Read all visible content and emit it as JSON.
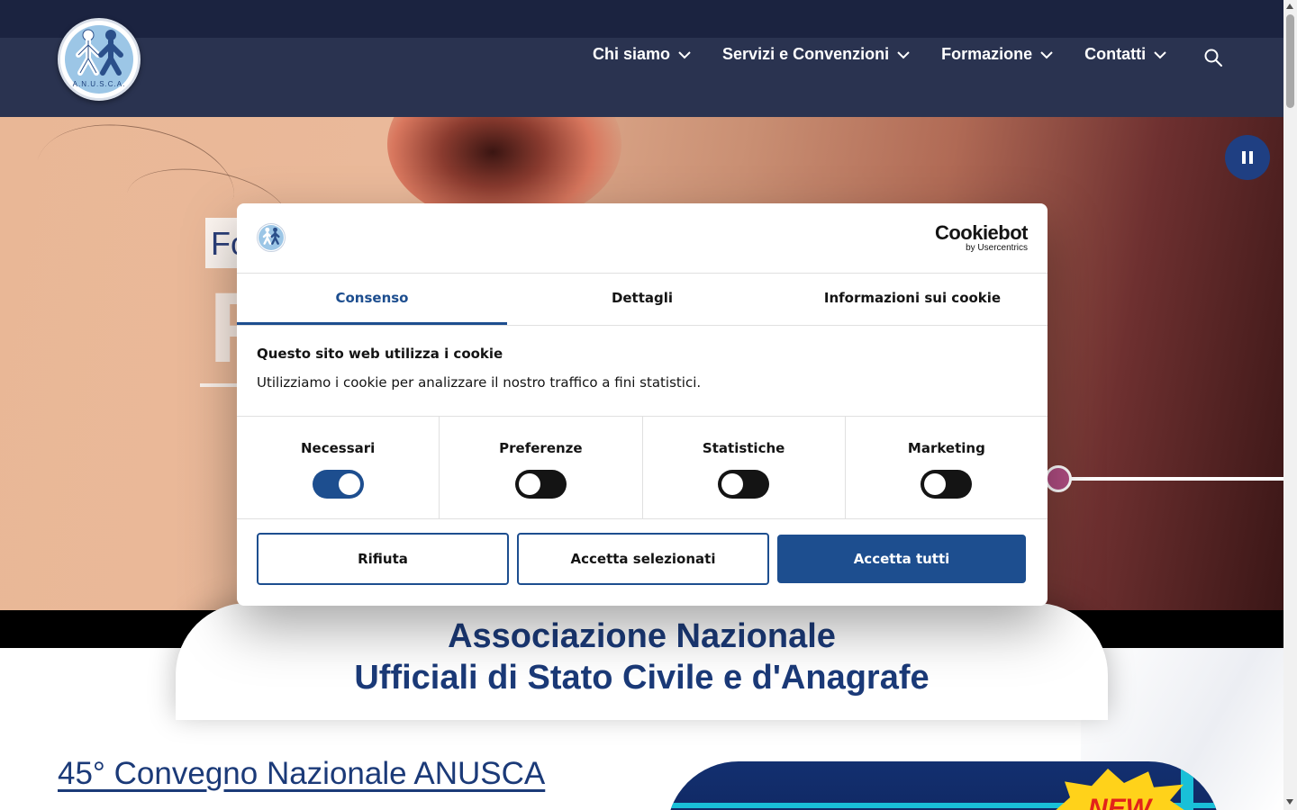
{
  "header": {
    "logo_text": "A.N.U.S.C.A.",
    "nav": [
      {
        "label": "Chi siamo"
      },
      {
        "label": "Servizi e Convenzioni"
      },
      {
        "label": "Formazione"
      },
      {
        "label": "Contatti"
      }
    ]
  },
  "hero": {
    "tag_text": "Fo",
    "big_letter": "F"
  },
  "main": {
    "title_line1": "Associazione Nazionale",
    "title_line2": "Ufficiali di Stato Civile e d'Anagrafe",
    "convegno_link": "45° Convegno Nazionale ANUSCA ",
    "promo_burst": "NEW"
  },
  "cookie": {
    "brand": "Cookiebot",
    "brand_sub": "by Usercentrics",
    "tabs": [
      "Consenso",
      "Dettagli",
      "Informazioni sui cookie"
    ],
    "active_tab": "Consenso",
    "title": "Questo sito web utilizza i cookie",
    "description": "Utilizziamo i cookie per analizzare il nostro traffico a fini statistici.",
    "categories": [
      {
        "label": "Necessari",
        "enabled": true
      },
      {
        "label": "Preferenze",
        "enabled": false
      },
      {
        "label": "Statistiche",
        "enabled": false
      },
      {
        "label": "Marketing",
        "enabled": false
      }
    ],
    "buttons": {
      "reject": "Rifiuta",
      "accept_selected": "Accetta selezionati",
      "accept_all": "Accetta tutti"
    }
  },
  "colors": {
    "primary": "#1d4e8f",
    "header_bg": "#2a3350",
    "title_blue": "#1b3a78",
    "slider_dot": "#b04d82"
  },
  "icons": [
    "logo-icon",
    "chevron-down-icon",
    "search-icon",
    "pause-icon"
  ]
}
